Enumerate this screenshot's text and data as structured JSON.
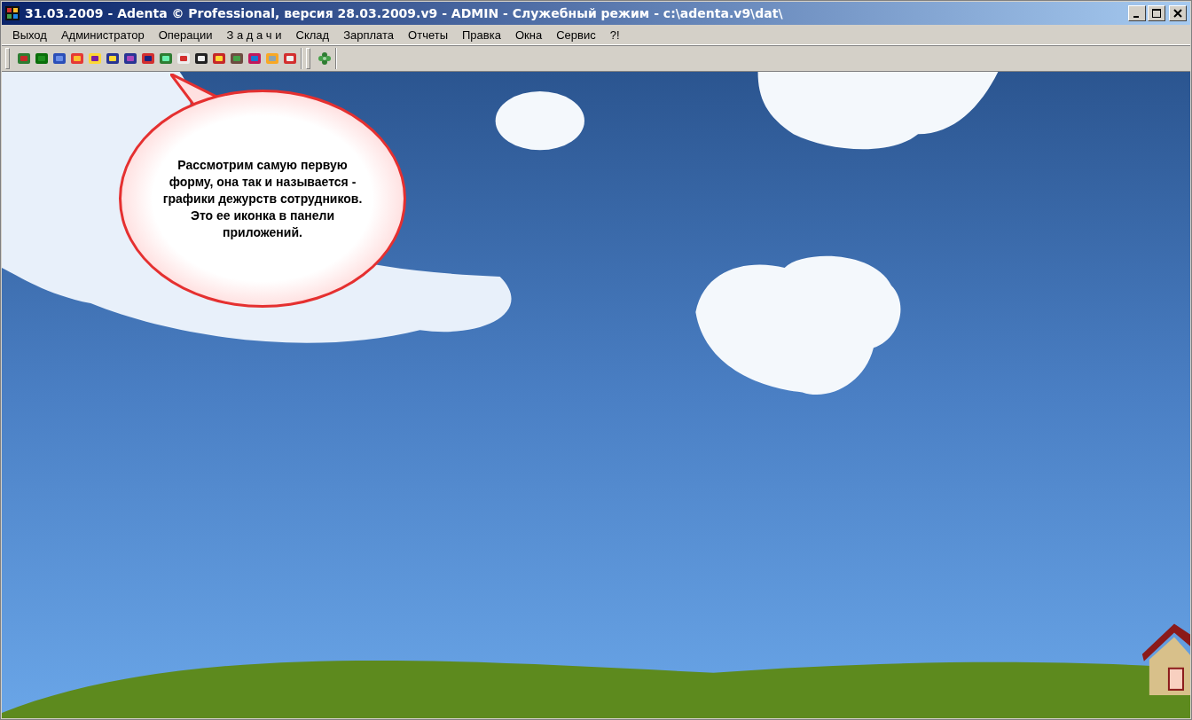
{
  "window": {
    "title": "31.03.2009 - Adenta © Professional, версия 28.03.2009.v9 - ADMIN - Служебный режим - c:\\adenta.v9\\dat\\"
  },
  "menu": [
    "Выход",
    "Администратор",
    "Операции",
    "З а д а ч и",
    "Склад",
    "Зарплата",
    "Отчеты",
    "Правка",
    "Окна",
    "Сервис",
    "?!"
  ],
  "callout": {
    "text": "Рассмотрим самую первую форму, она так и называется - графики дежурств сотрудников. Это ее иконка в панели приложений."
  }
}
